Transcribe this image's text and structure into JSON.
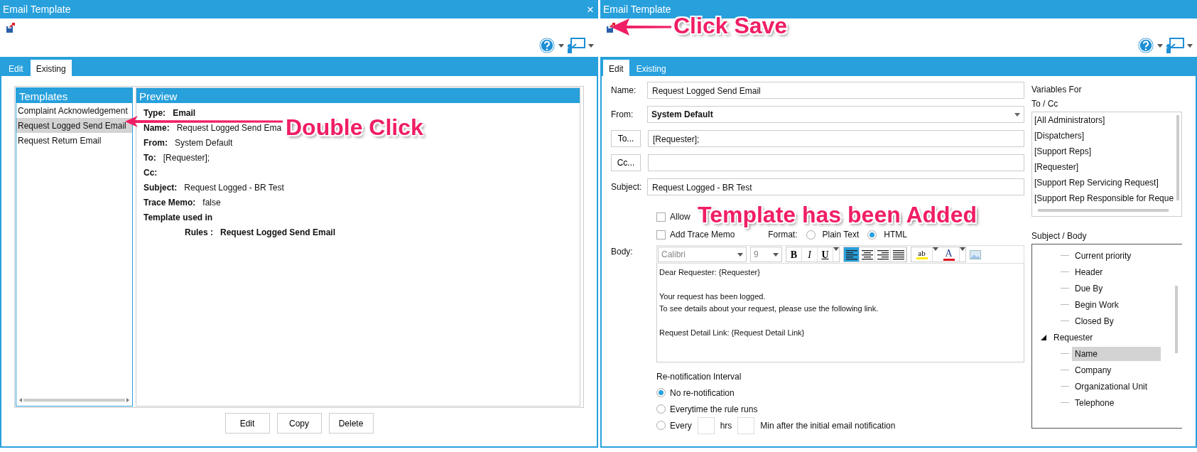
{
  "left_window": {
    "title": "Email Template",
    "close": "×",
    "tabs": [
      {
        "label": "Edit",
        "selected": false
      },
      {
        "label": "Existing",
        "selected": true
      }
    ],
    "templates": {
      "heading": "Templates",
      "items": [
        {
          "label": "Complaint Acknowledgement",
          "selected": false
        },
        {
          "label": "Request Logged Send Email",
          "selected": true
        },
        {
          "label": "Request Return Email",
          "selected": false
        }
      ]
    },
    "preview": {
      "heading": "Preview",
      "fields": [
        {
          "label": "Type:",
          "value": "Email",
          "bold_value": true
        },
        {
          "label": "Name:",
          "value": "Request Logged Send Ema",
          "bold_value": false
        },
        {
          "label": "From:",
          "value": "System Default",
          "bold_value": false
        },
        {
          "label": "To:",
          "value": "[Requester];",
          "bold_value": false
        },
        {
          "label": "Cc:"
        },
        {
          "label": "Subject:",
          "value": "Request Logged - BR Test",
          "bold_value": false
        },
        {
          "label": "Trace Memo:",
          "value": "false",
          "bold_value": false
        }
      ],
      "used_in": "Template used in",
      "rules_label": "Rules :",
      "rules_value": "Request Logged Send Email"
    },
    "buttons": [
      "Edit",
      "Copy",
      "Delete"
    ]
  },
  "right_window": {
    "title": "Email Template",
    "tabs": [
      {
        "label": "Edit",
        "selected": true
      },
      {
        "label": "Existing",
        "selected": false
      }
    ],
    "form": {
      "name_label": "Name:",
      "name_value": "Request Logged Send Email",
      "from_label": "From:",
      "from_value": "System Default",
      "to_button": "To...",
      "to_value": "[Requester];",
      "cc_button": "Cc...",
      "subject_label": "Subject:",
      "subject_value": "Request Logged - BR Test",
      "checkboxes": [
        {
          "label": "Allow",
          "checked": false
        },
        {
          "label": "Add Trace Memo",
          "checked": false
        }
      ],
      "format_label": "Format:",
      "format_options": [
        {
          "label": "Plain Text",
          "selected": false
        },
        {
          "label": "HTML",
          "selected": true
        }
      ],
      "body_label": "Body:",
      "editor_toolbar": {
        "font": "Calibri",
        "size": "9",
        "styles": [
          "B",
          "I",
          "U"
        ],
        "alignments": [
          {
            "kind": "left",
            "selected": true
          },
          {
            "kind": "center",
            "selected": false
          },
          {
            "kind": "right",
            "selected": false
          },
          {
            "kind": "justify",
            "selected": false
          }
        ],
        "highlight": "ab",
        "font_color": "A"
      },
      "body": "Dear Requester: {Requester}\n\nYour request has been logged.\nTo see details about your request, please use the following link.\n\nRequest Detail Link: {Request Detail Link}",
      "renotification": {
        "heading": "Re-notification Interval",
        "options": [
          {
            "label": "No re-notification",
            "selected": true,
            "kind": "plain"
          },
          {
            "label": "Everytime the rule runs",
            "selected": false,
            "kind": "plain"
          },
          {
            "label": "Every",
            "selected": false,
            "kind": "interval",
            "units": [
              "hrs",
              "Min after the initial email notification"
            ]
          }
        ]
      }
    },
    "variables": {
      "heading": "Variables For",
      "to_cc_label": "To / Cc",
      "to_cc_items": [
        "[All Administrators]",
        "[Dispatchers]",
        "[Support Reps]",
        "[Requester]",
        "[Support Rep Servicing Request]",
        "[Support Rep Responsible for Reque"
      ],
      "subject_body_label": "Subject / Body",
      "tree": [
        {
          "children": [
            {
              "label": "Current priority",
              "selected": false
            },
            {
              "label": "Header",
              "selected": false
            },
            {
              "label": "Due By",
              "selected": false
            },
            {
              "label": "Begin Work",
              "selected": false
            },
            {
              "label": "Closed By",
              "selected": false
            }
          ]
        },
        {
          "label": "Requester",
          "expanded": true,
          "selected": false,
          "children": [
            {
              "label": "Name",
              "selected": true
            },
            {
              "label": "Company",
              "selected": false
            },
            {
              "label": "Organizational Unit",
              "selected": false
            },
            {
              "label": "Telephone",
              "selected": false
            }
          ]
        }
      ]
    }
  },
  "annotations": [
    {
      "text": "Double Click",
      "arrow": true
    },
    {
      "text": "Click Save",
      "arrow": true
    },
    {
      "text": "Template has been Added",
      "arrow": false
    }
  ]
}
